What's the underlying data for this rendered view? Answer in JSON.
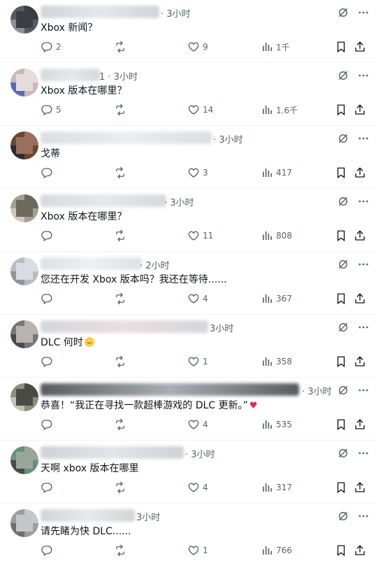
{
  "replies": [
    {
      "time": "· 3小时",
      "text": "Xbox 新闻？",
      "emoji": "",
      "replies": "2",
      "likes": "9",
      "views": "1千",
      "avatar_colors": [
        "#565b63",
        "#3a3d44",
        "#8a8f96"
      ],
      "name_colors": [
        "#c9ccd1",
        "#dfe3e8"
      ]
    },
    {
      "time": "1 · 3小时",
      "text": "Xbox 版本在哪里？",
      "emoji": "",
      "replies": "5",
      "likes": "14",
      "views": "1.6千",
      "avatar_colors": [
        "#c9b9b9",
        "#e6dcdc",
        "#5b6ab0"
      ],
      "name_colors": [
        "#cfd2d6",
        "#e1e4e8"
      ]
    },
    {
      "time": "· 3小时",
      "text": "戈蒂",
      "emoji": "",
      "replies": "",
      "likes": "3",
      "views": "417",
      "avatar_colors": [
        "#6b4634",
        "#9b6f5a",
        "#2e2a2c"
      ],
      "name_colors": [
        "#d6d8dc",
        "#e8eaee"
      ]
    },
    {
      "time": "· 3小时",
      "text": "Xbox 版本在哪里？",
      "emoji": "",
      "replies": "",
      "likes": "11",
      "views": "808",
      "avatar_colors": [
        "#a6a092",
        "#6e695d",
        "#cfc9bb"
      ],
      "name_colors": [
        "#d0d3d7",
        "#e2e5e9"
      ]
    },
    {
      "time": "· 2小时",
      "text": "您还在开发 Xbox 版本吗？我还在等待......",
      "emoji": "",
      "replies": "",
      "likes": "4",
      "views": "367",
      "avatar_colors": [
        "#b7bcc2",
        "#d9dde1",
        "#8d959d"
      ],
      "name_colors": [
        "#d8dbdf",
        "#eceef1"
      ]
    },
    {
      "time": "3小时",
      "text": "DLC 何时",
      "emoji": "face",
      "replies": "",
      "likes": "1",
      "views": "358",
      "avatar_colors": [
        "#7a7578",
        "#b9b3b0",
        "#4c484a"
      ],
      "name_colors": [
        "#cdd0d4",
        "#e8d8dc"
      ]
    },
    {
      "time": "· 3小时",
      "text": "恭喜！“我正在寻找一款超棒游戏的 DLC 更新。”",
      "emoji": "heart",
      "replies": "",
      "likes": "4",
      "views": "535",
      "avatar_colors": [
        "#8c8f7d",
        "#4a4b44",
        "#c2c4b8"
      ],
      "name_colors": [
        "#3c3f44",
        "#9aa0a6"
      ]
    },
    {
      "time": "· 3小时",
      "text": "天啊 xbox 版本在哪里",
      "emoji": "",
      "replies": "",
      "likes": "4",
      "views": "317",
      "avatar_colors": [
        "#6a8f7a",
        "#9aa69c",
        "#444d48"
      ],
      "name_colors": [
        "#c7cacf",
        "#dde0e4"
      ]
    },
    {
      "time": "3小时",
      "text": "请先睹为快 DLC......",
      "emoji": "",
      "replies": "",
      "likes": "1",
      "views": "766",
      "avatar_colors": [
        "#9a9c9f",
        "#c4c6c9",
        "#6d6f73"
      ],
      "name_colors": [
        "#c9ccd0",
        "#e3e6e9"
      ]
    }
  ]
}
